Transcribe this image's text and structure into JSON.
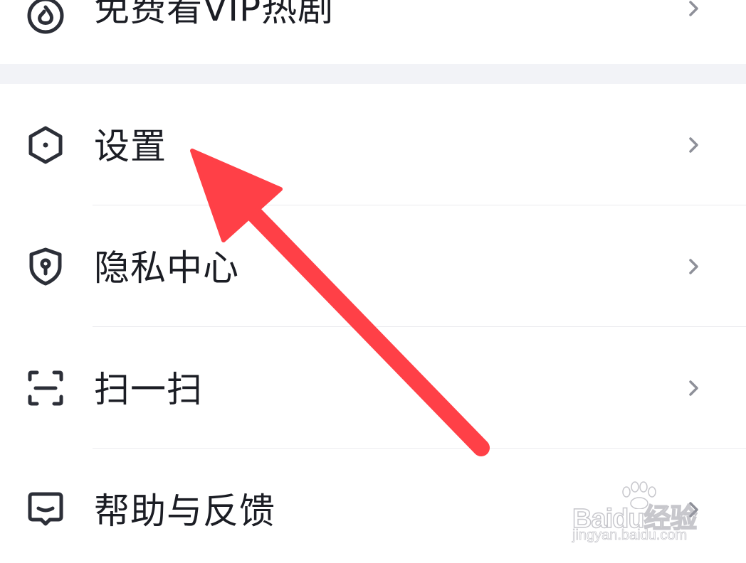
{
  "menu": {
    "items": [
      {
        "label": "免费看VIP热剧",
        "icon": "flame-icon"
      },
      {
        "label": "设置",
        "icon": "hexagon-settings-icon"
      },
      {
        "label": "隐私中心",
        "icon": "shield-keyhole-icon"
      },
      {
        "label": "扫一扫",
        "icon": "scan-icon"
      },
      {
        "label": "帮助与反馈",
        "icon": "feedback-chat-icon"
      }
    ],
    "chevron_icon": "chevron-right-icon"
  },
  "annotation": {
    "color": "#ff4047",
    "points_to": "设置"
  },
  "watermark": {
    "brand": "Baidu经验",
    "site": "jingyan.baidu.com"
  },
  "colors": {
    "text": "#1b1d24",
    "icon": "#2c2f38",
    "chevron": "#8e9099",
    "divider": "#ebebef",
    "section_bg": "#f2f3f7"
  }
}
